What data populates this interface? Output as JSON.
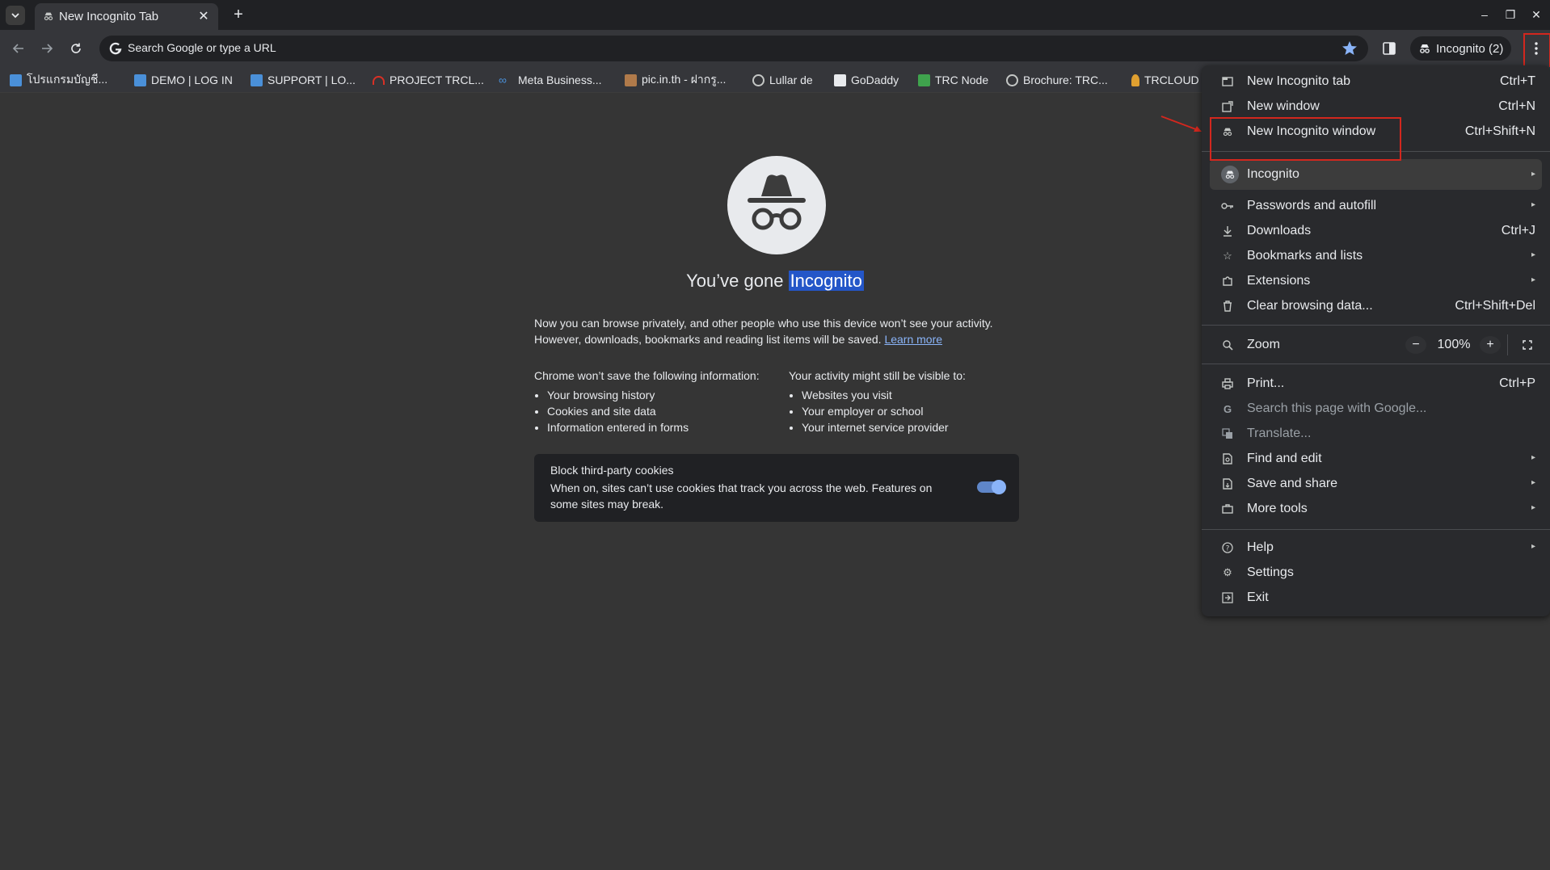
{
  "tabstrip": {
    "tab_title": "New Incognito Tab",
    "close_glyph": "✕",
    "new_tab_glyph": "+",
    "window_controls": {
      "minimize": "–",
      "restore": "❐",
      "close": "✕"
    }
  },
  "toolbar": {
    "omnibox_text": "Search Google or type a URL",
    "incognito_chip": "Incognito (2)"
  },
  "bookmarks": [
    {
      "label": "โปรแกรมบัญชี...",
      "icon": "cloud-icon",
      "color": "#4a90d9"
    },
    {
      "label": "DEMO | LOG IN",
      "icon": "cloud-icon",
      "color": "#4a90d9"
    },
    {
      "label": "SUPPORT | LO...",
      "icon": "cloud-icon",
      "color": "#4a90d9"
    },
    {
      "label": "PROJECT TRCL...",
      "icon": "horseshoe-icon",
      "color": "#d93025"
    },
    {
      "label": "Meta Business...",
      "icon": "meta-icon",
      "color": "#4a90d9"
    },
    {
      "label": "pic.in.th - ฝากรู...",
      "icon": "image-icon",
      "color": "#b07a4a"
    },
    {
      "label": "Lullar de",
      "icon": "globe-icon",
      "color": "#c4c7c5"
    },
    {
      "label": "GoDaddy",
      "icon": "godaddy-icon",
      "color": "#e8eaed"
    },
    {
      "label": "TRC Node",
      "icon": "trc-icon",
      "color": "#3fa34d"
    },
    {
      "label": "Brochure: TRC...",
      "icon": "globe-icon",
      "color": "#c4c7c5"
    },
    {
      "label": "TRCLOUD",
      "icon": "person-icon",
      "color": "#e0a030"
    }
  ],
  "page": {
    "headline_prefix": "You’ve gone",
    "headline_highlight": "Incognito",
    "desc_line1": "Now you can browse privately, and other people who use this device won’t see your activity.",
    "desc_line2": "However, downloads, bookmarks and reading list items will be saved.",
    "learn_more": "Learn more",
    "left_heading": "Chrome won’t save the following information:",
    "left_items": [
      "Your browsing history",
      "Cookies and site data",
      "Information entered in forms"
    ],
    "right_heading": "Your activity might still be visible to:",
    "right_items": [
      "Websites you visit",
      "Your employer or school",
      "Your internet service provider"
    ],
    "cookie_title": "Block third-party cookies",
    "cookie_desc": "When on, sites can’t use cookies that track you across the web. Features on some sites may break.",
    "cookie_toggle_on": true
  },
  "menu": {
    "items": [
      {
        "label": "New Incognito tab",
        "shortcut": "Ctrl+T",
        "icon": "new-tab-icon"
      },
      {
        "label": "New window",
        "shortcut": "Ctrl+N",
        "icon": "new-window-icon"
      },
      {
        "label": "New Incognito window",
        "shortcut": "Ctrl+Shift+N",
        "icon": "incognito-icon"
      },
      {
        "label": "Incognito",
        "icon": "incognito-avatar-icon"
      },
      {
        "label": "Passwords and autofill",
        "icon": "key-icon"
      },
      {
        "label": "Downloads",
        "shortcut": "Ctrl+J",
        "icon": "download-icon"
      },
      {
        "label": "Bookmarks and lists",
        "icon": "star-icon"
      },
      {
        "label": "Extensions",
        "icon": "puzzle-icon"
      },
      {
        "label": "Clear browsing data...",
        "shortcut": "Ctrl+Shift+Del",
        "icon": "trash-icon"
      },
      {
        "label": "Zoom",
        "icon": "zoom-icon"
      },
      {
        "label": "Print...",
        "shortcut": "Ctrl+P",
        "icon": "print-icon"
      },
      {
        "label": "Search this page with Google...",
        "icon": "google-icon"
      },
      {
        "label": "Translate...",
        "icon": "translate-icon"
      },
      {
        "label": "Find and edit",
        "icon": "find-icon"
      },
      {
        "label": "Save and share",
        "icon": "save-icon"
      },
      {
        "label": "More tools",
        "icon": "toolbox-icon"
      },
      {
        "label": "Help",
        "icon": "help-icon"
      },
      {
        "label": "Settings",
        "icon": "gear-icon"
      },
      {
        "label": "Exit",
        "icon": "exit-icon"
      }
    ],
    "zoom": {
      "minus": "−",
      "value": "100%",
      "plus": "+"
    }
  },
  "colors": {
    "annotation_red": "#d2271e",
    "highlight_blue": "#2456c8",
    "link_blue": "#8ab4f8"
  }
}
